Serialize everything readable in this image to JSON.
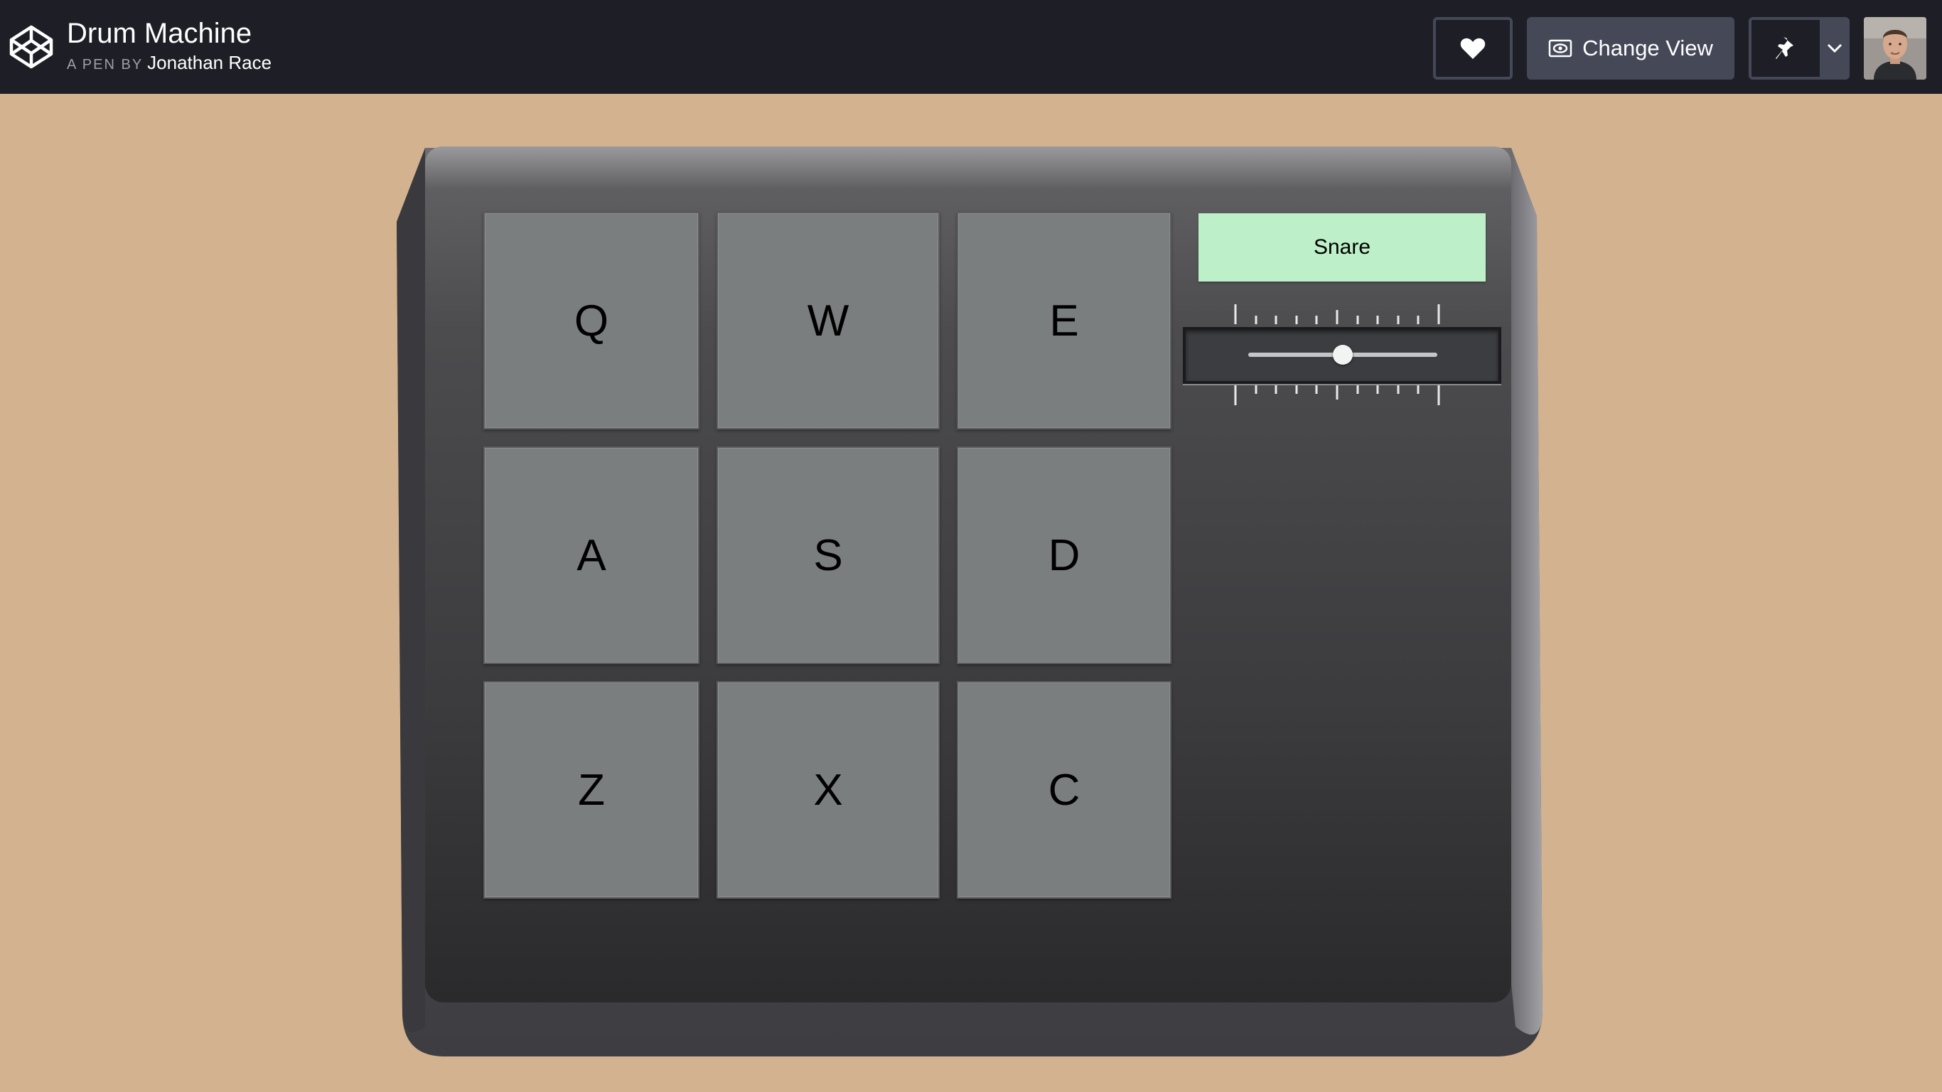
{
  "header": {
    "title": "Drum Machine",
    "pen_by": "A PEN BY",
    "author": "Jonathan Race",
    "change_view_label": "Change View",
    "icons": {
      "logo": "codepen-logo-icon",
      "like": "heart-icon",
      "view": "eye-icon",
      "pin": "pin-icon",
      "menu": "chevron-down-icon"
    }
  },
  "machine": {
    "pads": [
      "Q",
      "W",
      "E",
      "A",
      "S",
      "D",
      "Z",
      "X",
      "C"
    ],
    "display_text": "Snare",
    "volume_level": 0.5,
    "colors": {
      "background": "#d3b290",
      "pad": "#7b7e7f",
      "display": "#bdf0c9",
      "header": "#1e1f26"
    }
  }
}
